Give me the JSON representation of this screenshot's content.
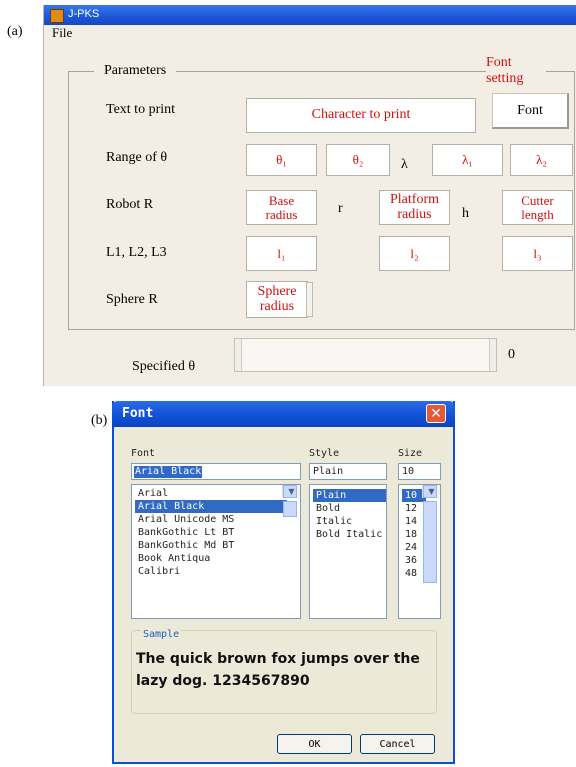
{
  "labels": {
    "a": "(a)",
    "b": "(b)"
  },
  "window_a": {
    "title": "J-PKS",
    "menu": {
      "file": "File"
    },
    "parameters_title": "Parameters",
    "font_setting": "Font\nsetting",
    "rows": {
      "text_to_print": "Text to print",
      "range_theta": "Range of θ",
      "robot_r": "Robot R",
      "l123": "L1, L2, L3",
      "sphere_r": "Sphere R"
    },
    "fields": {
      "character_to_print": "Character to print",
      "theta1": "θ₁",
      "theta2": "θ₂",
      "lambda1": "λ₁",
      "lambda2": "λ₂",
      "base_radius": "Base\nradius",
      "platform_radius": "Platform\nradius",
      "cutter_length": "Cutter\nlength",
      "l1": "l₁",
      "l2": "l₂",
      "l3": "l₃",
      "sphere_radius": "Sphere\nradius"
    },
    "inline": {
      "lambda": "λ",
      "r": "r",
      "h": "h"
    },
    "font_button": "Font",
    "specified_theta": "Specified θ",
    "slider_value": "0"
  },
  "window_b": {
    "title": "Font",
    "font_header": "Font",
    "style_header": "Style",
    "size_header": "Size",
    "font_value": "Arial Black",
    "style_value": "Plain",
    "size_value": "10",
    "fonts": [
      "Arial",
      "Arial Black",
      "Arial Unicode MS",
      "BankGothic Lt BT",
      "BankGothic Md BT",
      "Book Antiqua",
      "Calibri"
    ],
    "selected_font": "Arial Black",
    "styles": [
      "Plain",
      "Bold",
      "Italic",
      "Bold Italic"
    ],
    "selected_style": "Plain",
    "sizes": [
      "10",
      "12",
      "14",
      "18",
      "24",
      "36",
      "48"
    ],
    "selected_size": "10",
    "sample_label": "Sample",
    "sample_text": "The quick brown fox jumps over the lazy dog.  1234567890",
    "ok": "OK",
    "cancel": "Cancel"
  },
  "colors": {
    "field_text": "#d01010",
    "title_blue": "#1c56d8",
    "selection": "#316ac5"
  }
}
